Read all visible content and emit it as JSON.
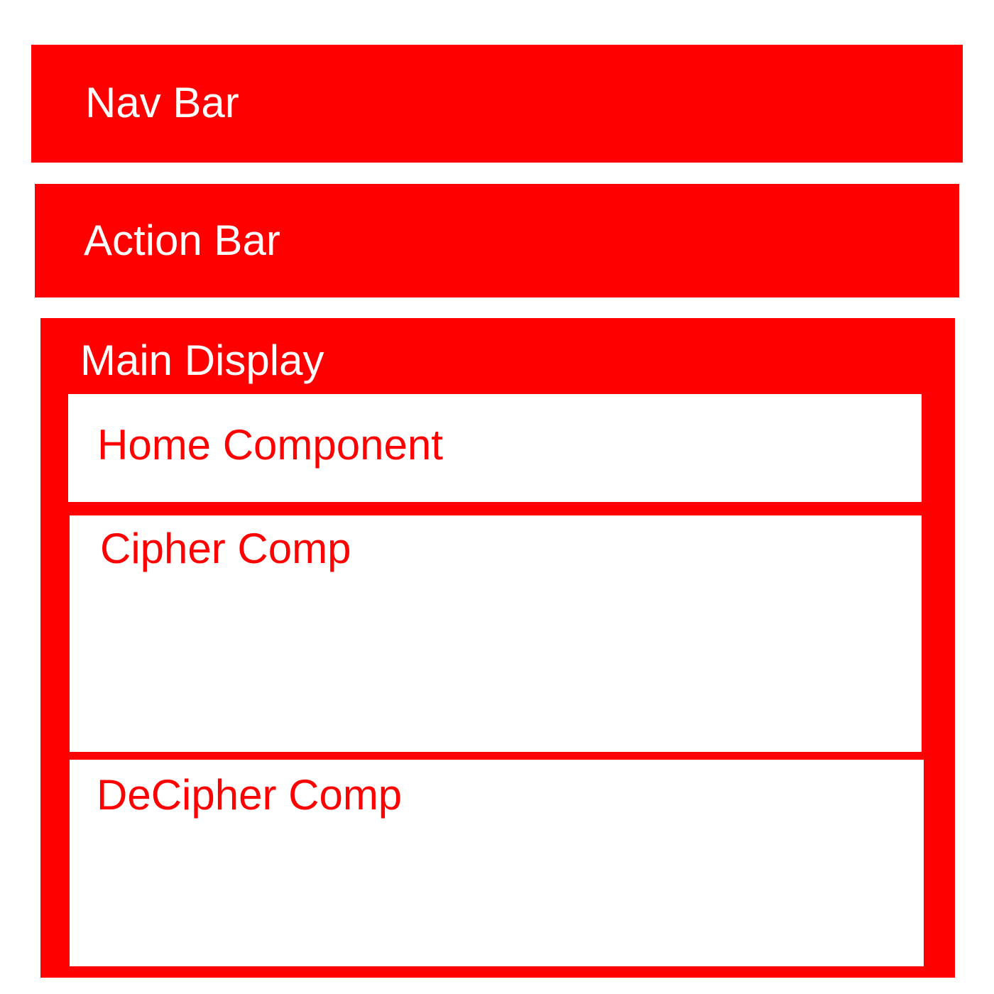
{
  "colors": {
    "accent": "#ff0000",
    "text_on_accent": "#ffffff",
    "component_background": "#ffffff"
  },
  "nav_bar": {
    "label": "Nav Bar"
  },
  "action_bar": {
    "label": "Action Bar"
  },
  "main_display": {
    "label": "Main Display",
    "components": {
      "home": {
        "label": "Home Component"
      },
      "cipher": {
        "label": "Cipher Comp"
      },
      "decipher": {
        "label": "DeCipher Comp"
      }
    }
  }
}
